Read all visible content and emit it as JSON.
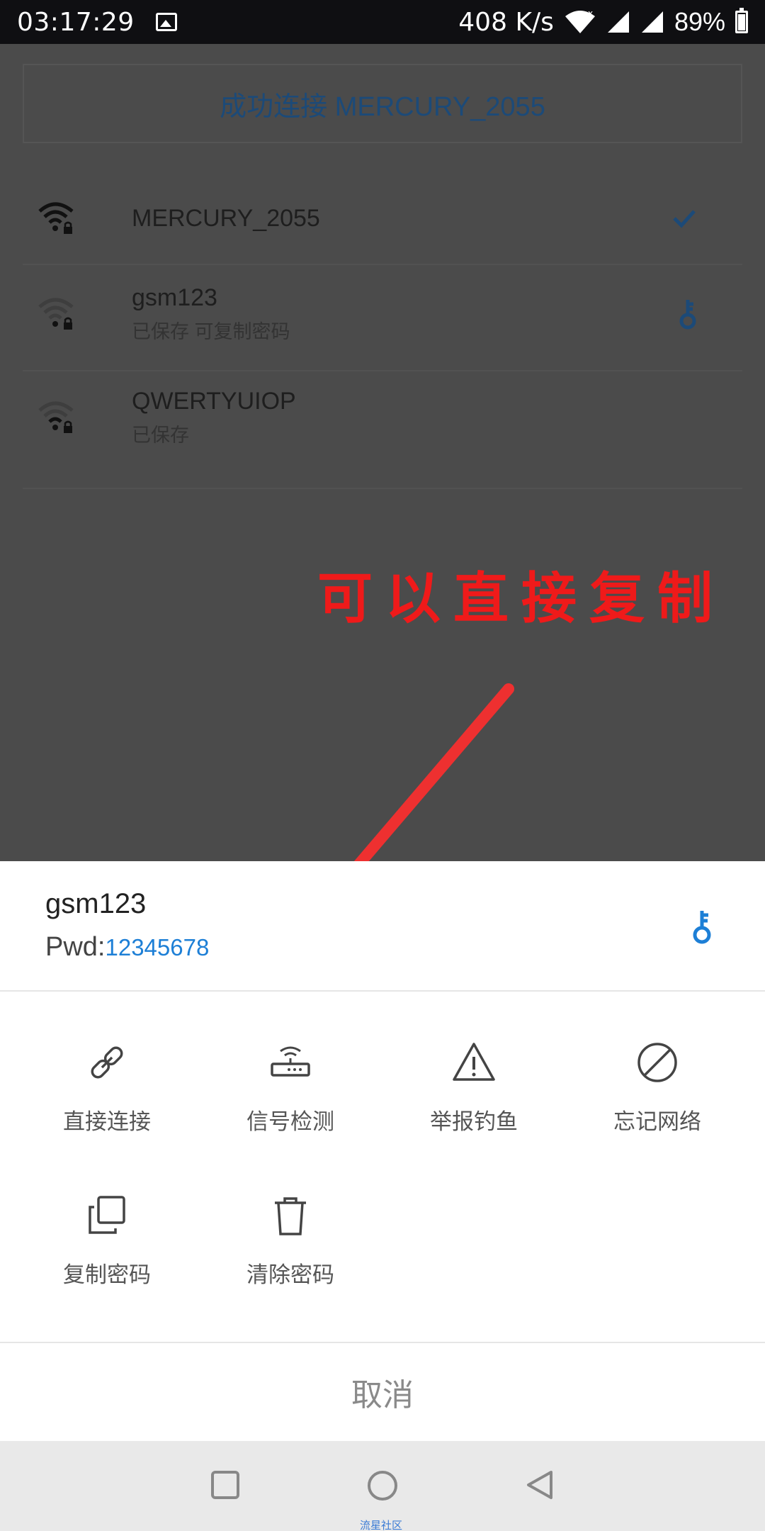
{
  "status_bar": {
    "time": "03:17:29",
    "speed": "408 K/s",
    "battery": "89%",
    "battery_level": 0.89
  },
  "page": {
    "connected_banner": "成功连接 MERCURY_2055",
    "networks": [
      {
        "name": "MERCURY_2055",
        "subtitle": ""
      },
      {
        "name": "gsm123",
        "subtitle": "已保存 可复制密码"
      },
      {
        "name": "QWERTYUIOP",
        "subtitle": "已保存"
      }
    ]
  },
  "annotation": {
    "text": "可以直接复制",
    "color": "#ef1a1a"
  },
  "sheet": {
    "ssid": "gsm123",
    "pwd_label": "Pwd:",
    "pwd_value": "12345678",
    "actions": [
      {
        "label": "直接连接",
        "icon": "link-icon"
      },
      {
        "label": "信号检测",
        "icon": "router-icon"
      },
      {
        "label": "举报钓鱼",
        "icon": "warning-icon"
      },
      {
        "label": "忘记网络",
        "icon": "forbidden-icon"
      },
      {
        "label": "复制密码",
        "icon": "copy-icon"
      },
      {
        "label": "清除密码",
        "icon": "trash-icon"
      }
    ],
    "cancel_label": "取消"
  },
  "navbar": {
    "watermark": "流星社区"
  },
  "colors": {
    "accent": "#1d7fd6",
    "banner_text": "#1c4a78"
  }
}
